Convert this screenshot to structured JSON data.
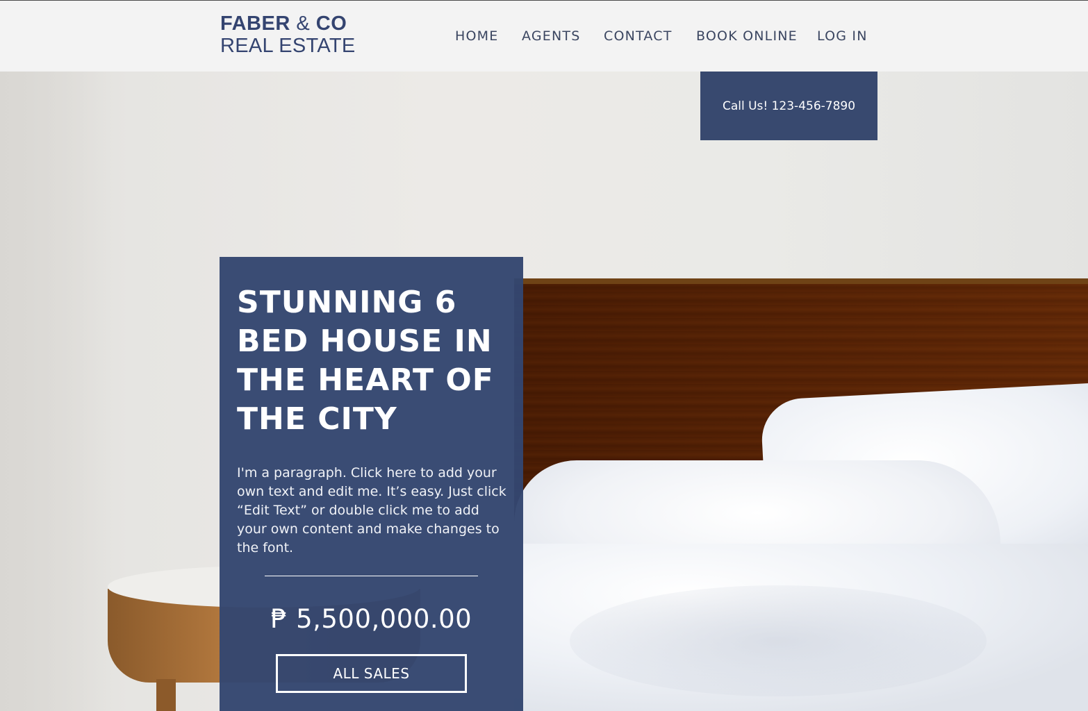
{
  "header": {
    "logo_line1_a": "FABER",
    "logo_amp": "&",
    "logo_line1_b": "CO",
    "logo_line2": "REAL ESTATE",
    "nav": [
      {
        "label": "HOME"
      },
      {
        "label": "AGENTS"
      },
      {
        "label": "CONTACT"
      },
      {
        "label": "BOOK ONLINE"
      },
      {
        "label": "LOG IN"
      }
    ]
  },
  "call_button": {
    "label": "Call Us! 123-456-7890"
  },
  "listing": {
    "title": "STUNNING 6 BED HOUSE IN THE HEART OF THE CITY",
    "paragraph": "I'm a paragraph. Click here to add your own text and edit me. It’s easy. Just click “Edit Text” or double click me to add your own content and make changes to the font.",
    "price": "₱ 5,500,000.00",
    "button_label": "ALL SALES"
  },
  "colors": {
    "brand_navy": "#344470",
    "header_bg": "#f3f3f3",
    "panel_bg": "#344670",
    "wood": "#9c6429"
  }
}
